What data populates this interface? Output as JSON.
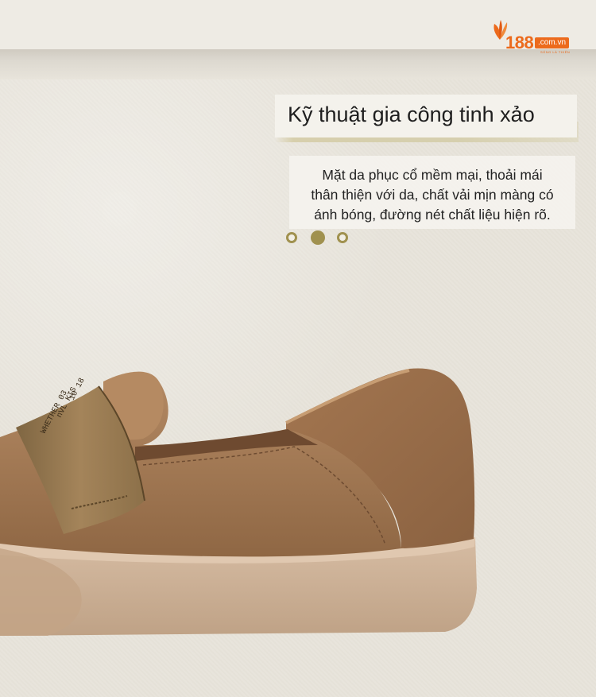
{
  "logo": {
    "number": "188",
    "domain": ".com.vn",
    "tagline": "SỐNG LÀ THIÊN",
    "brand_color": "#ec6a1c"
  },
  "feature": {
    "title": "Kỹ thuật gia công tinh xảo",
    "description_lines": [
      "Mặt da phục cổ mềm mại, thoải mái",
      "thân thiện với da, chất vải mịn màng có",
      "ánh bóng, đường nét chất liệu hiện rõ."
    ]
  },
  "pager": {
    "count": 3,
    "active_index": 1,
    "accent_color": "#a0914f"
  },
  "product_image": {
    "strap_print_lines": [
      "10 18",
      "nVL KIS",
      "WHETHER 03",
      "ANG"
    ],
    "colors": {
      "upper": "#a47a55",
      "strap": "#9a7a52",
      "sole": "#cdb196"
    }
  }
}
